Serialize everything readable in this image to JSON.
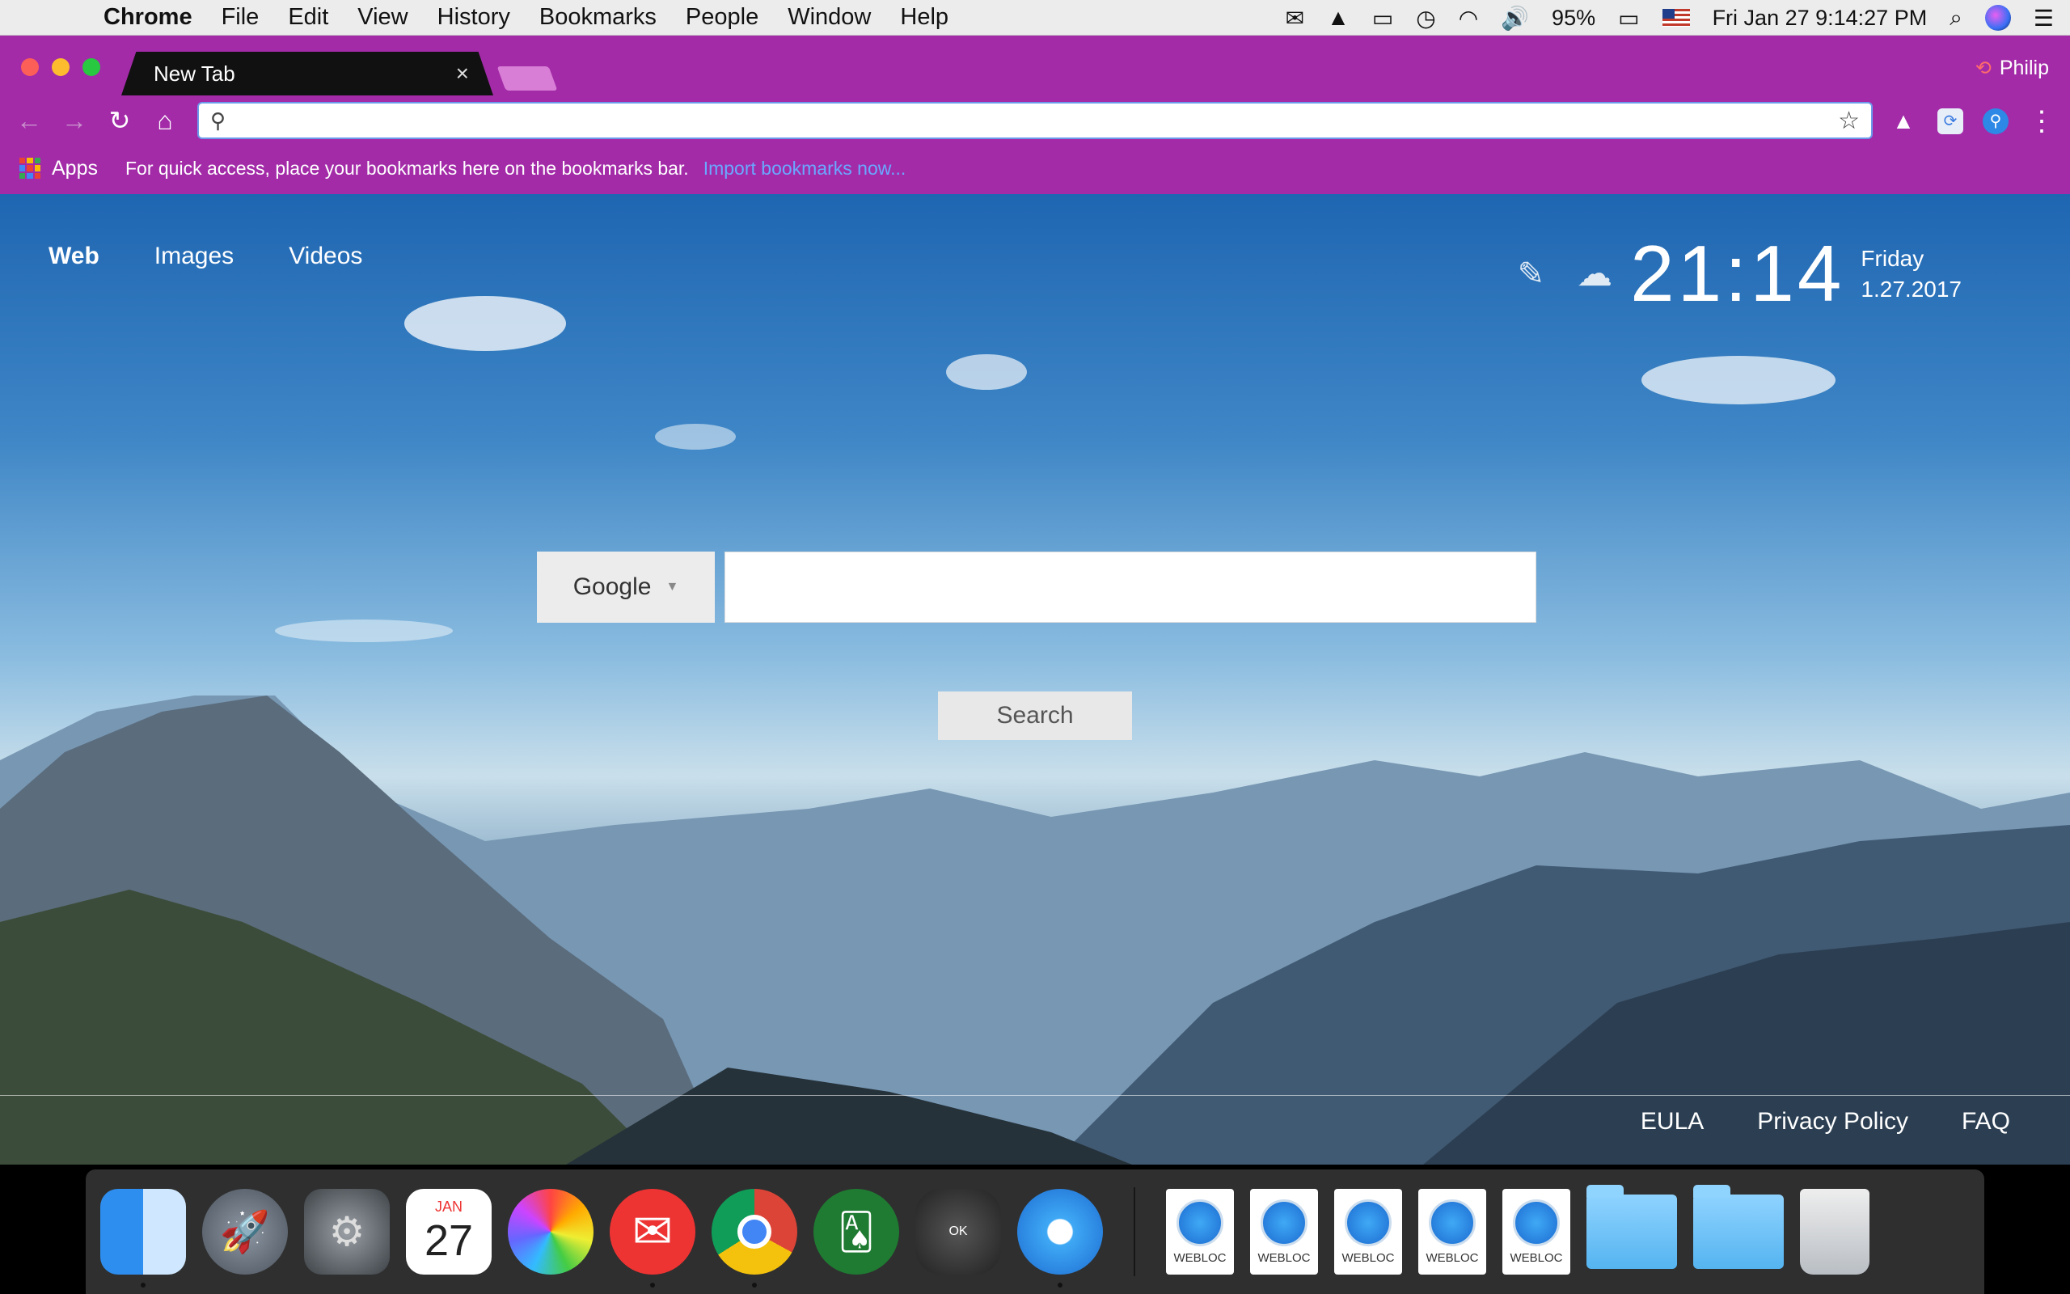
{
  "menubar": {
    "app_name": "Chrome",
    "items": [
      "File",
      "Edit",
      "View",
      "History",
      "Bookmarks",
      "People",
      "Window",
      "Help"
    ],
    "battery": "95%",
    "datetime": "Fri Jan 27  9:14:27 PM"
  },
  "browser": {
    "tab_title": "New Tab",
    "tab_close": "×",
    "profile_name": "Philip",
    "omnibox_value": "",
    "bookmarks": {
      "apps_label": "Apps",
      "hint": "For quick access, place your bookmarks here on the bookmarks bar.",
      "import_link": "Import bookmarks now..."
    }
  },
  "page": {
    "nav": [
      "Web",
      "Images",
      "Videos"
    ],
    "clock": {
      "time": "21:14",
      "day": "Friday",
      "date": "1.27.2017"
    },
    "search": {
      "engine": "Google",
      "query": "",
      "button": "Search"
    },
    "footer": [
      "EULA",
      "Privacy Policy",
      "FAQ"
    ]
  },
  "dock": {
    "calendar_month": "JAN",
    "calendar_day": "27",
    "webloc_label": "WEBLOC"
  },
  "colors": {
    "chrome_theme": "#a32ba8",
    "omnibox_focus": "#6b9bea"
  }
}
